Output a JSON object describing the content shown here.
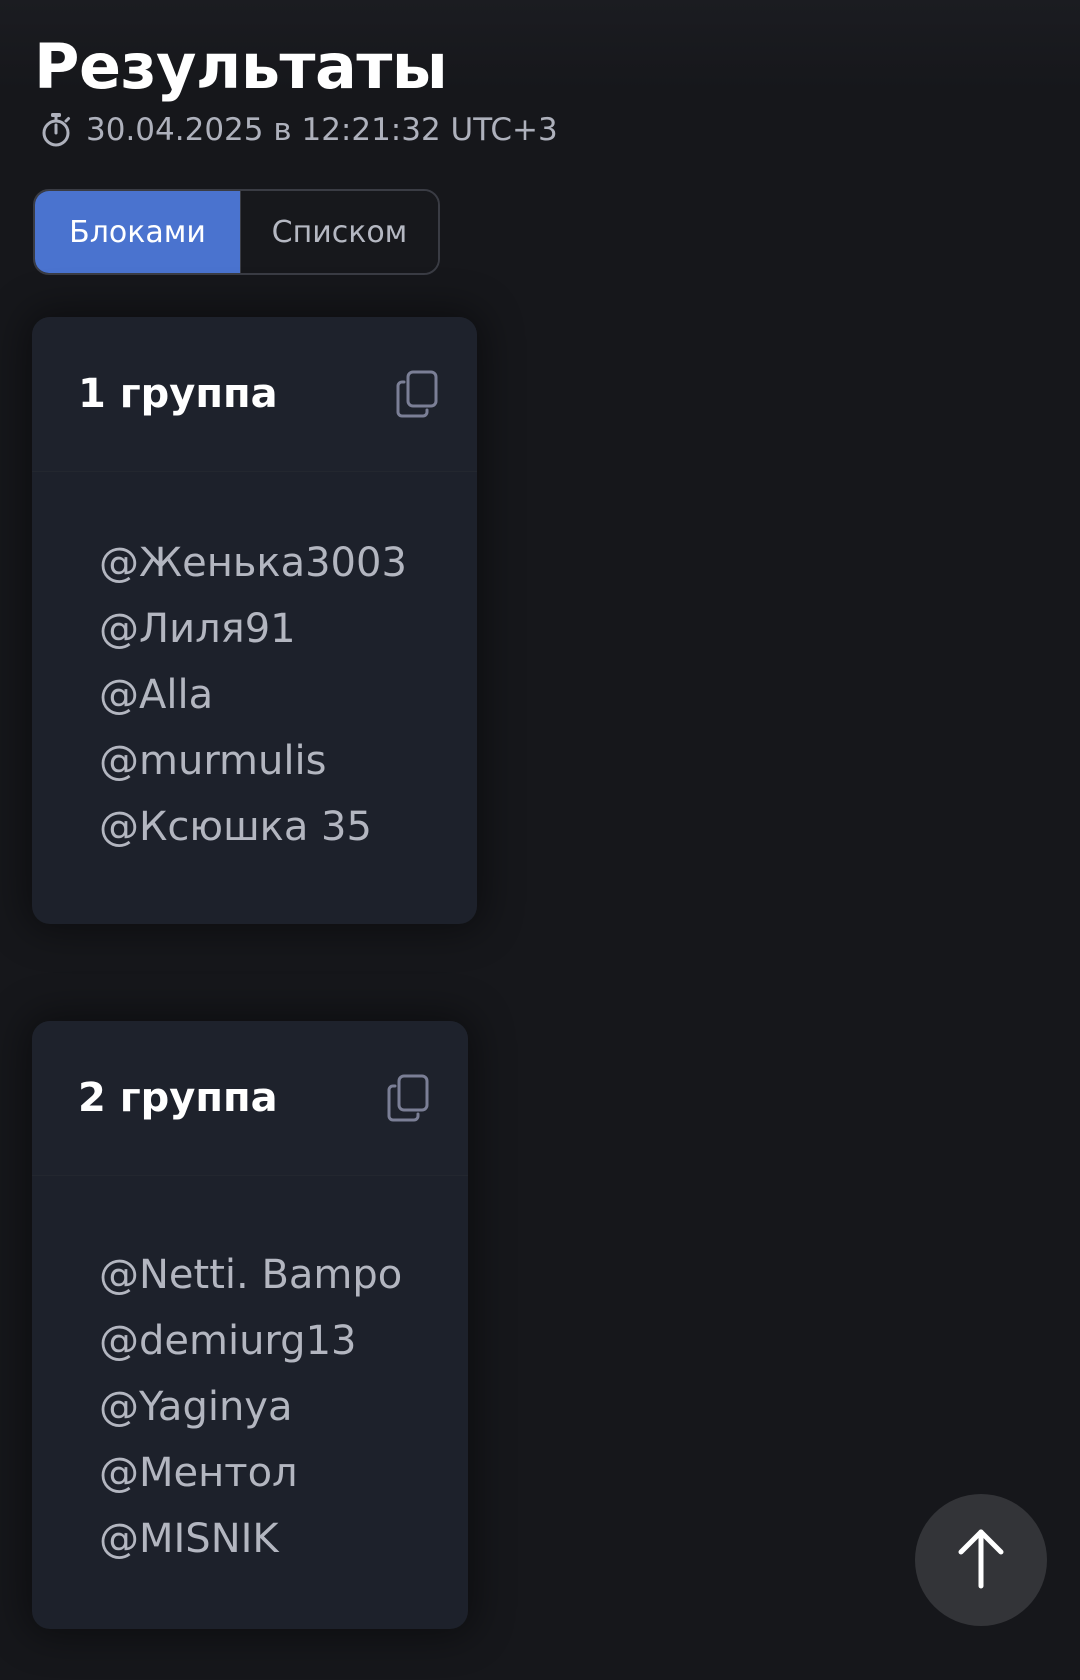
{
  "header": {
    "title": "Результаты",
    "timestamp": "30.04.2025 в 12:21:32 UTC+3",
    "timestamp_icon": "stopwatch-icon"
  },
  "view_toggle": {
    "options": [
      "Блоками",
      "Списком"
    ],
    "selected": "Блоками",
    "active_color": "#4a73cf"
  },
  "groups": [
    {
      "name": "1 группа",
      "members": [
        "@Женька3003",
        "@Лиля91",
        "@Alla",
        "@murmulis",
        "@Ксюшка 35"
      ]
    },
    {
      "name": "2 группа",
      "members": [
        "@Netti. Bampo",
        "@demiurg13",
        "@Yaginya",
        "@Ментол",
        "@MISNIK"
      ]
    }
  ],
  "icons": {
    "copy": "copy-icon",
    "scroll_top": "arrow-up-icon"
  },
  "colors": {
    "background": "#16171b",
    "card": "#1d212b",
    "accent": "#4a73cf"
  }
}
